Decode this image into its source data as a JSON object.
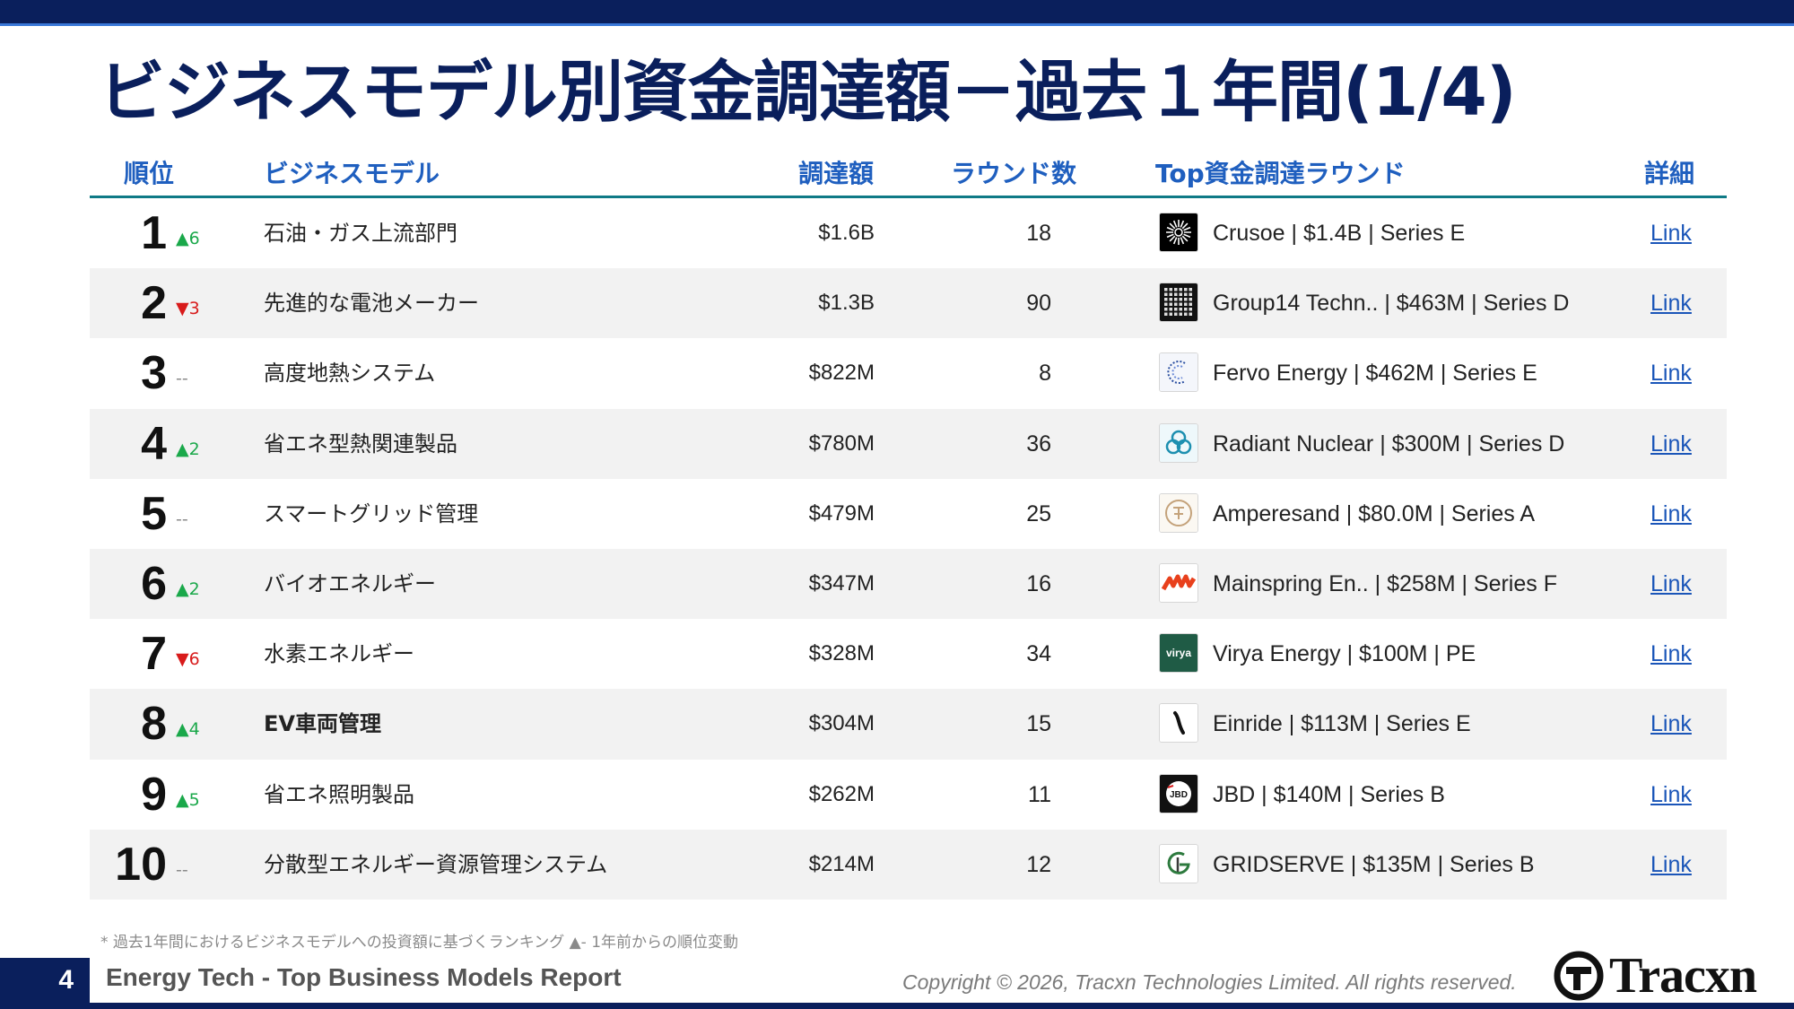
{
  "title": "ビジネスモデル別資金調達額－過去１年間(1/4)",
  "headers": {
    "rank": "順位",
    "model": "ビジネスモデル",
    "amount": "調達額",
    "rounds": "ラウンド数",
    "top_round": "Top資金調達ラウンド",
    "detail": "詳細"
  },
  "rows": [
    {
      "rank": "1",
      "change": "▲6",
      "dir": "up",
      "model": "石油・ガス上流部門",
      "amount": "$1.6B",
      "rounds": "18",
      "top_round": "Crusoe | $1.4B | Series E",
      "logo": "crusoe-logo",
      "link": "Link"
    },
    {
      "rank": "2",
      "change": "▼3",
      "dir": "down",
      "model": "先進的な電池メーカー",
      "amount": "$1.3B",
      "rounds": "90",
      "top_round": "Group14 Techn.. | $463M | Series D",
      "logo": "group14-logo",
      "link": "Link"
    },
    {
      "rank": "3",
      "change": "--",
      "dir": "none",
      "model": "高度地熱システム",
      "amount": "$822M",
      "rounds": "8",
      "top_round": "Fervo Energy | $462M | Series E",
      "logo": "fervo-logo",
      "link": "Link"
    },
    {
      "rank": "4",
      "change": "▲2",
      "dir": "up",
      "model": "省エネ型熱関連製品",
      "amount": "$780M",
      "rounds": "36",
      "top_round": "Radiant Nuclear | $300M | Series D",
      "logo": "radiant-logo",
      "link": "Link"
    },
    {
      "rank": "5",
      "change": "--",
      "dir": "none",
      "model": "スマートグリッド管理",
      "amount": "$479M",
      "rounds": "25",
      "top_round": "Amperesand | $80.0M | Series A",
      "logo": "amperesand-logo",
      "link": "Link"
    },
    {
      "rank": "6",
      "change": "▲2",
      "dir": "up",
      "model": "バイオエネルギー",
      "amount": "$347M",
      "rounds": "16",
      "top_round": "Mainspring En.. | $258M | Series F",
      "logo": "mainspring-logo",
      "link": "Link"
    },
    {
      "rank": "7",
      "change": "▼6",
      "dir": "down",
      "model": "水素エネルギー",
      "amount": "$328M",
      "rounds": "34",
      "top_round": "Virya Energy | $100M | PE",
      "logo": "virya-logo",
      "logo_text": "virya",
      "link": "Link"
    },
    {
      "rank": "8",
      "change": "▲4",
      "dir": "up",
      "model": "EV車両管理",
      "amount": "$304M",
      "rounds": "15",
      "top_round": "Einride | $113M | Series E",
      "logo": "einride-logo",
      "link": "Link"
    },
    {
      "rank": "9",
      "change": "▲5",
      "dir": "up",
      "model": "省エネ照明製品",
      "amount": "$262M",
      "rounds": "11",
      "top_round": "JBD | $140M | Series B",
      "logo": "jbd-logo",
      "logo_text": "JBD",
      "link": "Link"
    },
    {
      "rank": "10",
      "change": "--",
      "dir": "none",
      "model": "分散型エネルギー資源管理システム",
      "amount": "$214M",
      "rounds": "12",
      "top_round": "GRIDSERVE | $135M | Series B",
      "logo": "gridserve-logo",
      "link": "Link"
    }
  ],
  "footnote": "* 過去1年間におけるビジネスモデルへの投資額に基づくランキング ▲- 1年前からの順位変動",
  "footer": {
    "page": "4",
    "report_title": "Energy Tech - Top Business Models Report",
    "copyright": "Copyright © 2026, Tracxn Technologies Limited. All rights reserved.",
    "brand": "Tracxn"
  },
  "colors": {
    "navy": "#0a1f5c",
    "header_blue": "#1f5fbf",
    "teal_rule": "#0f7a86",
    "up_green": "#1aa84a",
    "down_red": "#d81b1b",
    "link_blue": "#1a55b8"
  }
}
